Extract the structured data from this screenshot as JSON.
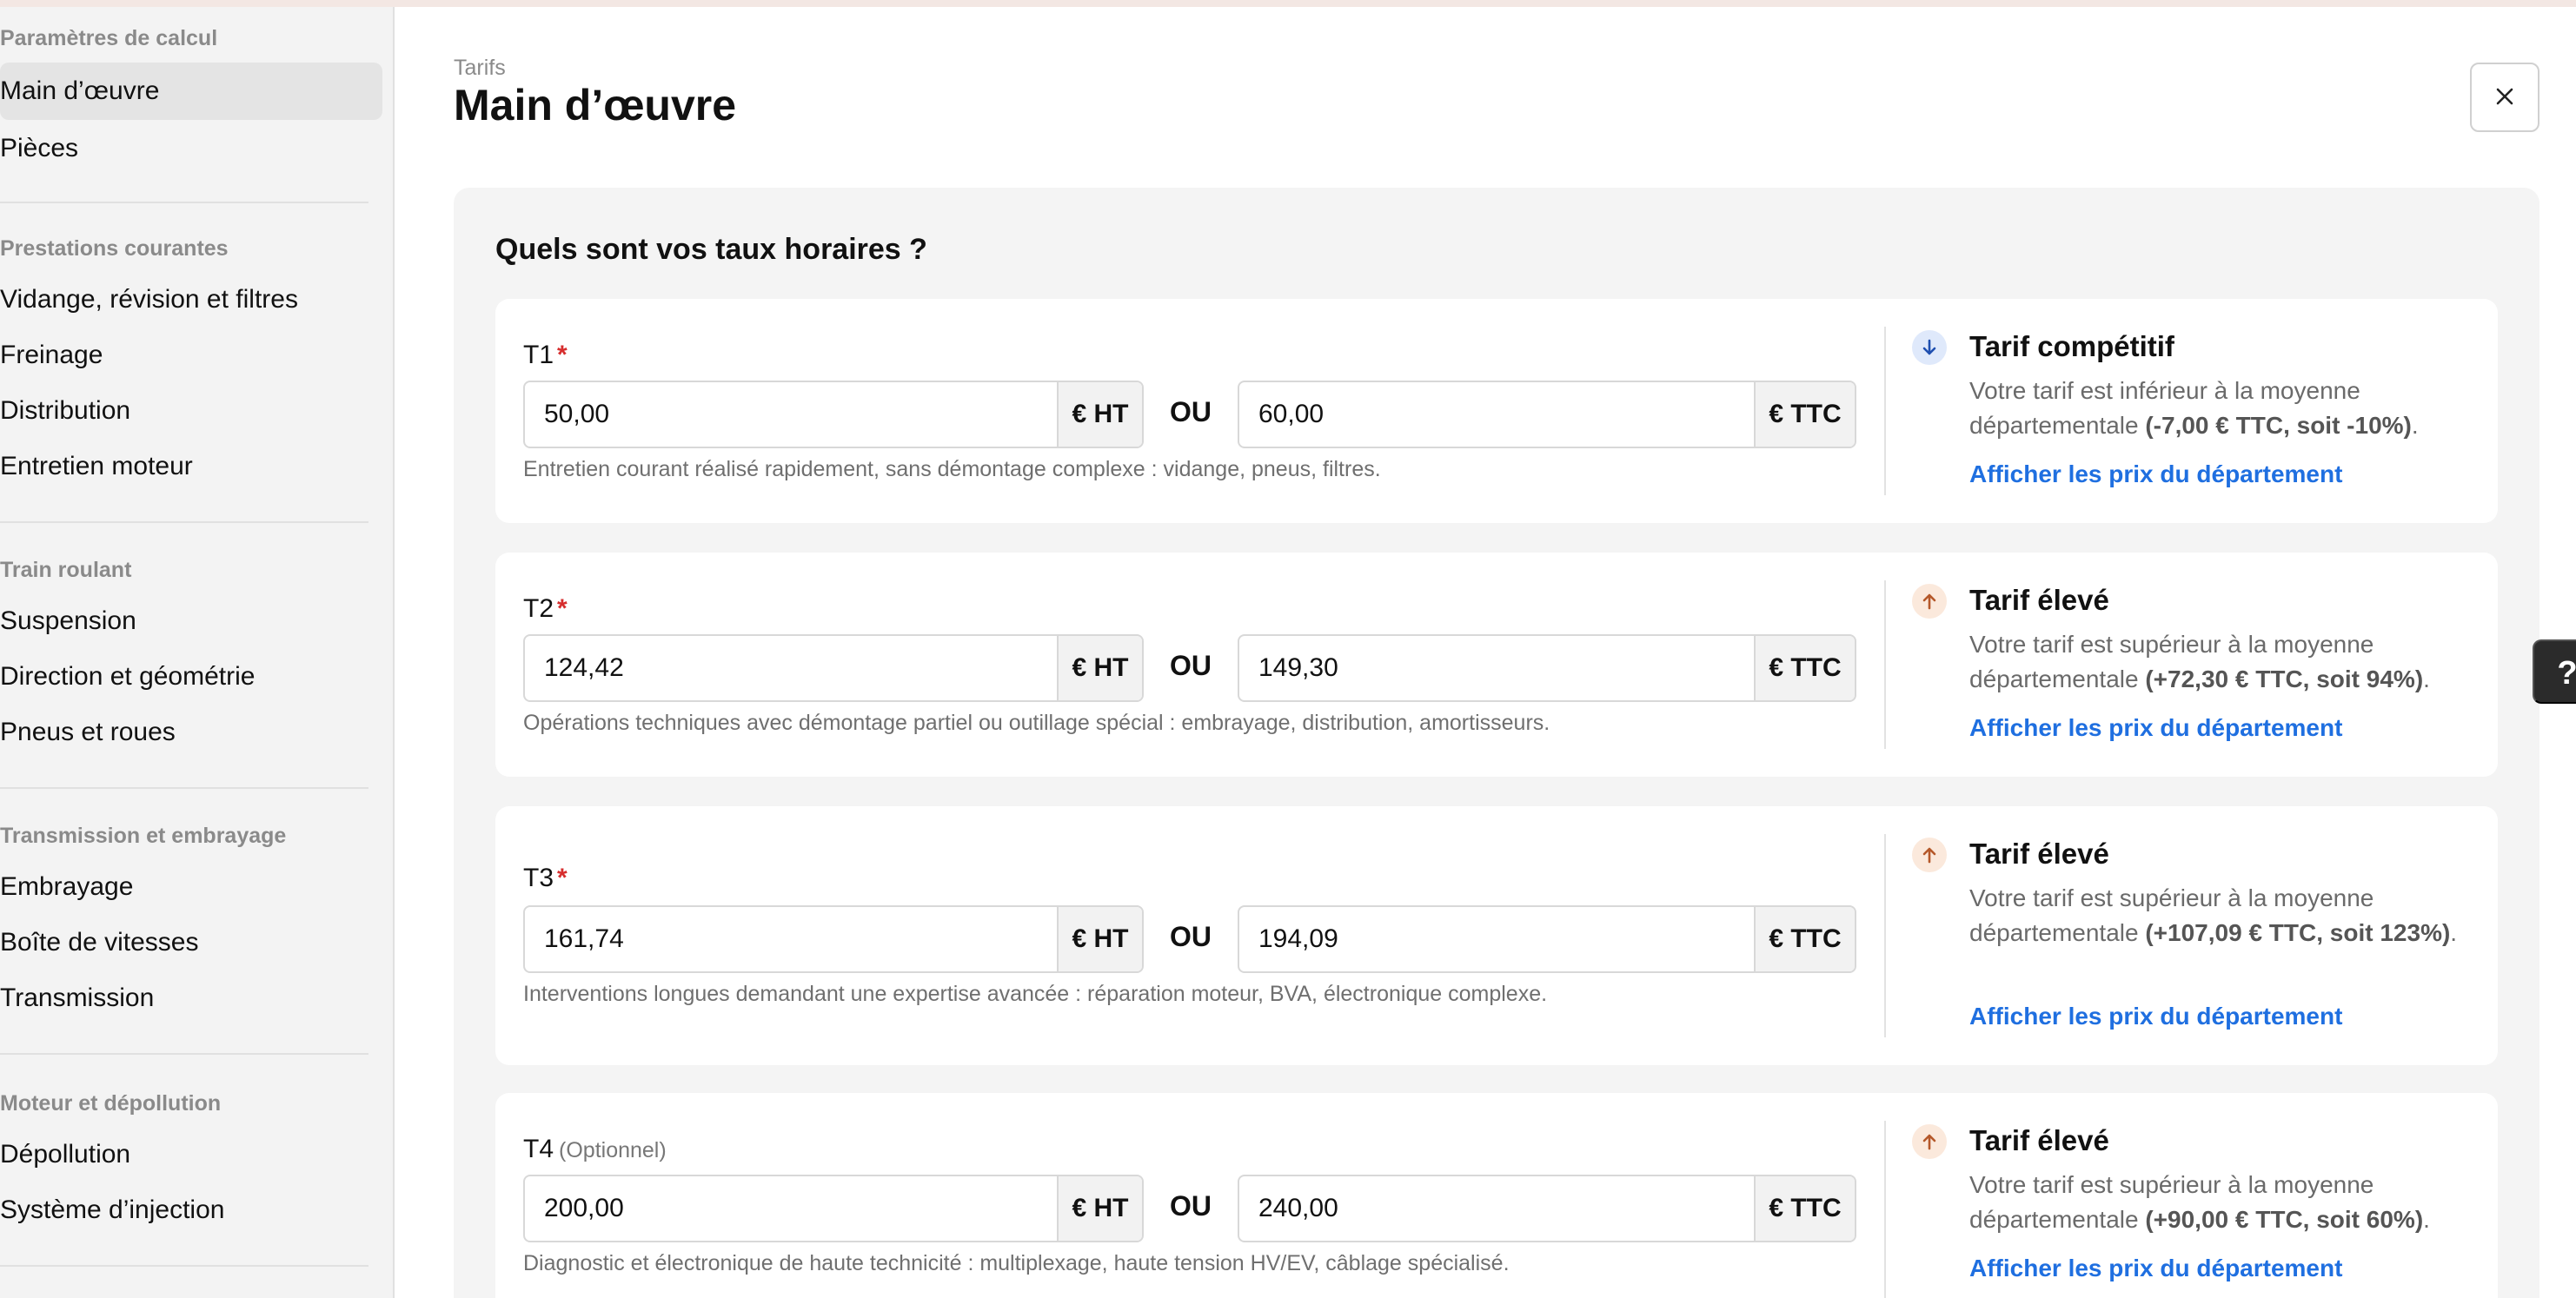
{
  "sidebar": {
    "sections": [
      {
        "title": "Paramètres de calcul",
        "items": [
          "Main d’œuvre",
          "Pièces"
        ]
      },
      {
        "title": "Prestations courantes",
        "items": [
          "Vidange, révision et filtres",
          "Freinage",
          "Distribution",
          "Entretien moteur"
        ]
      },
      {
        "title": "Train roulant",
        "items": [
          "Suspension",
          "Direction et géométrie",
          "Pneus et roues"
        ]
      },
      {
        "title": "Transmission et embrayage",
        "items": [
          "Embrayage",
          "Boîte de vitesses",
          "Transmission"
        ]
      },
      {
        "title": "Moteur et dépollution",
        "items": [
          "Dépollution",
          "Système d’injection"
        ]
      }
    ],
    "active_item": "Main d’œuvre"
  },
  "header": {
    "subtitle": "Tarifs",
    "title": "Main d’œuvre",
    "close_icon": "close-icon"
  },
  "panel": {
    "title": "Quels sont vos taux horaires ?",
    "or_label": "OU",
    "ht_suffix": "€ HT",
    "ttc_suffix": "€ TTC",
    "tiers": [
      {
        "label": "T1",
        "marker": "*",
        "ht": "50,00",
        "ttc": "60,00",
        "hint": "Entretien courant réalisé rapidement, sans démontage complexe : vidange, pneus, filtres.",
        "status": {
          "icon": "arrow-down-icon",
          "title": "Tarif compétitif",
          "desc": "Votre tarif est inférieur à la moyenne départementale ",
          "desc_bold": "(-7,00 € TTC, soit -10%)",
          "desc_end": ".",
          "link": "Afficher les prix du département"
        }
      },
      {
        "label": "T2",
        "marker": "*",
        "ht": "124,42",
        "ttc": "149,30",
        "hint": "Opérations techniques avec démontage partiel ou outillage spécial : embrayage, distribution, amortisseurs.",
        "status": {
          "icon": "arrow-up-icon",
          "title": "Tarif élevé",
          "desc": "Votre tarif est supérieur à la moyenne départementale ",
          "desc_bold": "(+72,30 € TTC, soit 94%)",
          "desc_end": ".",
          "link": "Afficher les prix du département"
        }
      },
      {
        "label": "T3",
        "marker": "*",
        "ht": "161,74",
        "ttc": "194,09",
        "hint": "Interventions longues demandant une expertise avancée : réparation moteur, BVA, électronique complexe.",
        "status": {
          "icon": "arrow-up-icon",
          "title": "Tarif élevé",
          "desc": "Votre tarif est supérieur à la moyenne départementale ",
          "desc_bold": "(+107,09 € TTC, soit 123%)",
          "desc_end": ".",
          "link": "Afficher les prix du département"
        }
      },
      {
        "label": "T4",
        "optional": "(Optionnel)",
        "ht": "200,00",
        "ttc": "240,00",
        "hint": "Diagnostic et électronique de haute technicité : multiplexage, haute tension HV/EV, câblage spécialisé.",
        "status": {
          "icon": "arrow-up-icon",
          "title": "Tarif élevé",
          "desc": "Votre tarif est supérieur à la moyenne départementale ",
          "desc_bold": "(+90,00 € TTC, soit 60%)",
          "desc_end": ".",
          "link": "Afficher les prix du département"
        }
      }
    ]
  },
  "help_button": "?",
  "colors": {
    "link": "#1f6fe0",
    "required": "#d62d2d",
    "competitive_bg": "#dfe9fb",
    "high_bg": "#fbe9dc"
  }
}
